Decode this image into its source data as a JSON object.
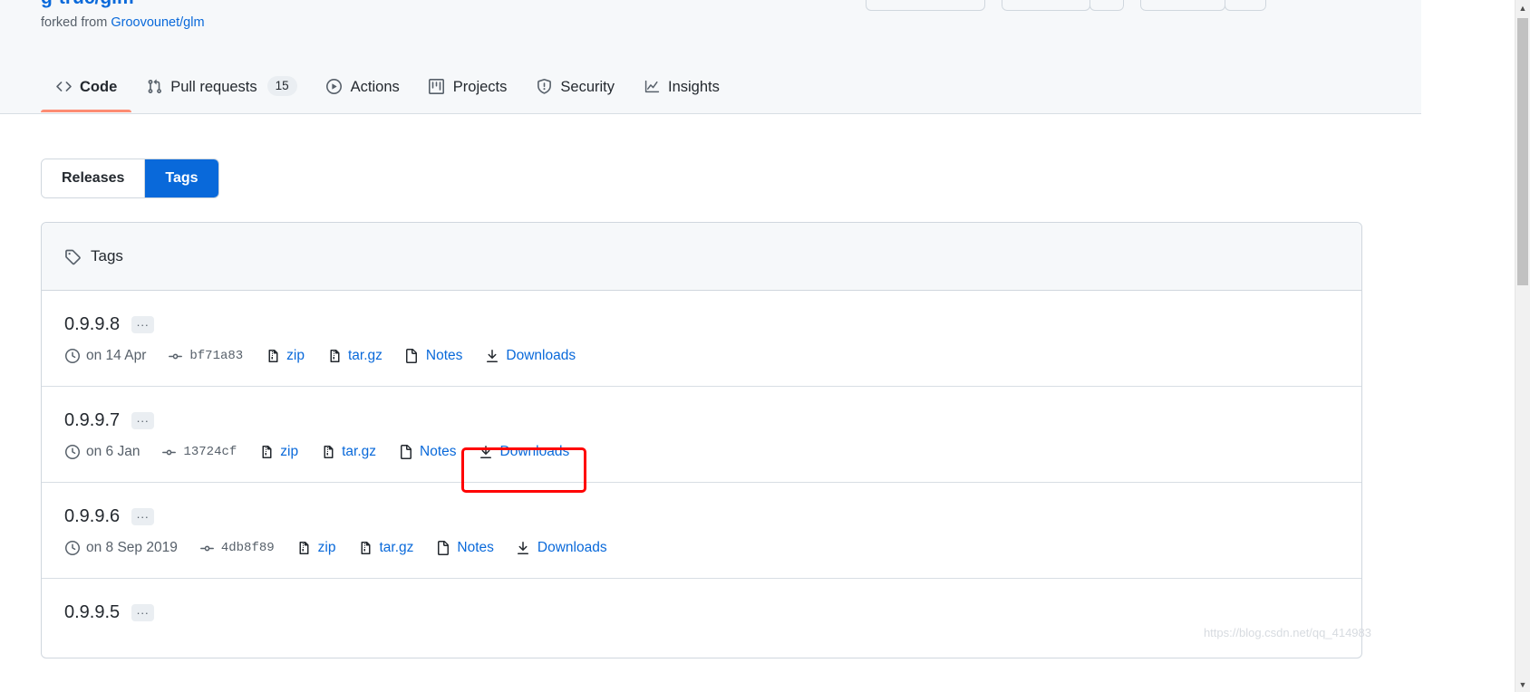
{
  "repo": {
    "title": "g-truc/glm",
    "forked_prefix": "forked from",
    "forked_from": "Groovounet/glm"
  },
  "nav": {
    "items": [
      {
        "label": "Code",
        "icon": "code-icon",
        "active": true,
        "count": null
      },
      {
        "label": "Pull requests",
        "icon": "git-pull-request-icon",
        "active": false,
        "count": "15"
      },
      {
        "label": "Actions",
        "icon": "play-icon",
        "active": false,
        "count": null
      },
      {
        "label": "Projects",
        "icon": "project-board-icon",
        "active": false,
        "count": null
      },
      {
        "label": "Security",
        "icon": "shield-icon",
        "active": false,
        "count": null
      },
      {
        "label": "Insights",
        "icon": "graph-icon",
        "active": false,
        "count": null
      }
    ]
  },
  "segmented": {
    "releases_label": "Releases",
    "tags_label": "Tags",
    "selected": "Tags",
    "selected_color": "#0969da"
  },
  "tags_panel": {
    "header_title": "Tags",
    "header_icon": "tag-icon",
    "rows": [
      {
        "name": "0.9.9.8",
        "menu_label": "...",
        "date": "on 14 Apr",
        "commit": "bf71a83",
        "zip_label": "zip",
        "targz_label": "tar.gz",
        "notes_label": "Notes",
        "downloads_label": "Downloads"
      },
      {
        "name": "0.9.9.7",
        "menu_label": "...",
        "date": "on 6 Jan",
        "commit": "13724cf",
        "zip_label": "zip",
        "targz_label": "tar.gz",
        "notes_label": "Notes",
        "downloads_label": "Downloads"
      },
      {
        "name": "0.9.9.6",
        "menu_label": "...",
        "date": "on 8 Sep 2019",
        "commit": "4db8f89",
        "zip_label": "zip",
        "targz_label": "tar.gz",
        "notes_label": "Notes",
        "downloads_label": "Downloads"
      },
      {
        "name": "0.9.9.5",
        "menu_label": "...",
        "date": "",
        "commit": "",
        "zip_label": "",
        "targz_label": "",
        "notes_label": "",
        "downloads_label": ""
      }
    ]
  },
  "annotation": {
    "color": "#ff0000",
    "target": "Downloads"
  },
  "watermark": {
    "text": "https://blog.csdn.net/qq_414983"
  }
}
